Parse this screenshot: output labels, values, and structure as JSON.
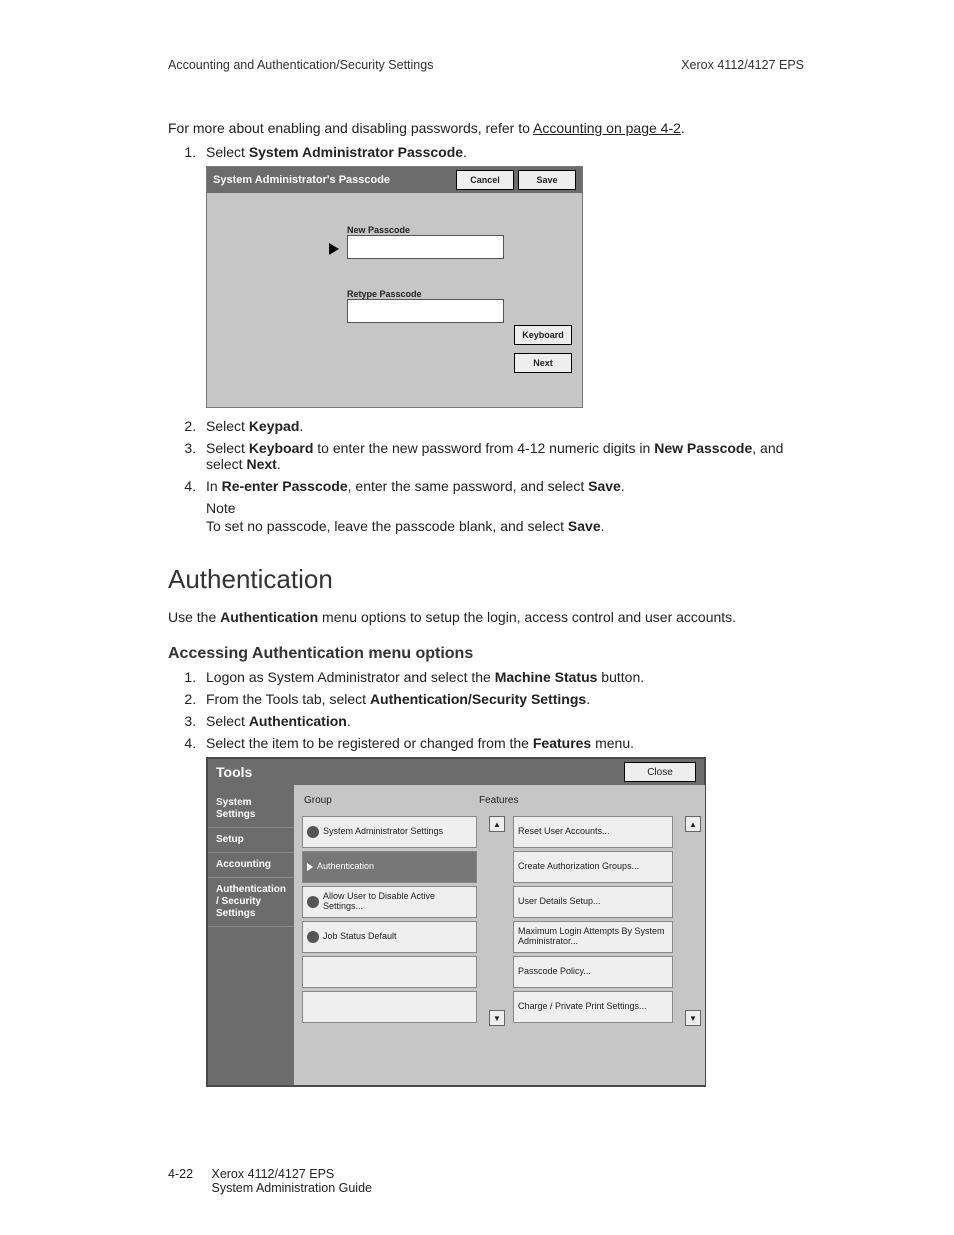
{
  "header": {
    "left": "Accounting and Authentication/Security Settings",
    "right": "Xerox 4112/4127 EPS"
  },
  "intro": {
    "text_pre": "For more about enabling and disabling passwords, refer to ",
    "link": "Accounting on page 4-2",
    "text_post": "."
  },
  "list1": {
    "i1_pre": "Select ",
    "i1_bold": "System Administrator Passcode",
    "i1_post": ".",
    "i2_pre": "Select ",
    "i2_bold": "Keypad",
    "i2_post": ".",
    "i3_pre": "Select ",
    "i3_bold1": "Keyboard",
    "i3_mid": " to enter the new password from 4-12 numeric digits in ",
    "i3_bold2": "New Passcode",
    "i3_mid2": ", and select ",
    "i3_bold3": "Next",
    "i3_post": ".",
    "i4_pre": "In ",
    "i4_bold1": "Re-enter Passcode",
    "i4_mid": ", enter the same password, and select ",
    "i4_bold2": "Save",
    "i4_post": ".",
    "note_title": "Note",
    "note_pre": "To set no passcode, leave the passcode blank, and select ",
    "note_bold": "Save",
    "note_post": "."
  },
  "shot1": {
    "title": "System Administrator's Passcode",
    "cancel": "Cancel",
    "save": "Save",
    "new_label": "New Passcode",
    "retype_label": "Retype Passcode",
    "keyboard": "Keyboard",
    "next": "Next"
  },
  "h1": "Authentication",
  "auth_intro_pre": "Use the ",
  "auth_intro_bold": "Authentication",
  "auth_intro_post": " menu options to setup the login, access control and user accounts.",
  "h2": "Accessing Authentication menu options",
  "list2": {
    "i1_pre": "Logon as System Administrator and select the ",
    "i1_bold": "Machine Status",
    "i1_post": " button.",
    "i2_pre": "From the Tools tab, select ",
    "i2_bold": "Authentication/Security Settings",
    "i2_post": ".",
    "i3_pre": "Select ",
    "i3_bold": "Authentication",
    "i3_post": ".",
    "i4_pre": "Select the item to be registered or changed from the ",
    "i4_bold": "Features",
    "i4_post": " menu."
  },
  "shot2": {
    "title": "Tools",
    "close": "Close",
    "tabs": {
      "t0": "System Settings",
      "t1": "Setup",
      "t2": "Accounting",
      "t3": "Authentication / Security Settings"
    },
    "col_group": "Group",
    "col_features": "Features",
    "group": {
      "g0": "System Administrator Settings",
      "g1": "Authentication",
      "g2": "Allow User to Disable Active Settings...",
      "g3": "Job Status Default"
    },
    "features": {
      "f0": "Reset User Accounts...",
      "f1": "Create Authorization Groups...",
      "f2": "User Details Setup...",
      "f3": "Maximum Login Attempts By System Administrator...",
      "f4": "Passcode Policy...",
      "f5": "Charge / Private Print Settings..."
    }
  },
  "footer": {
    "pagenum": "4-22",
    "doc1": "Xerox 4112/4127 EPS",
    "doc2": "System Administration Guide"
  }
}
